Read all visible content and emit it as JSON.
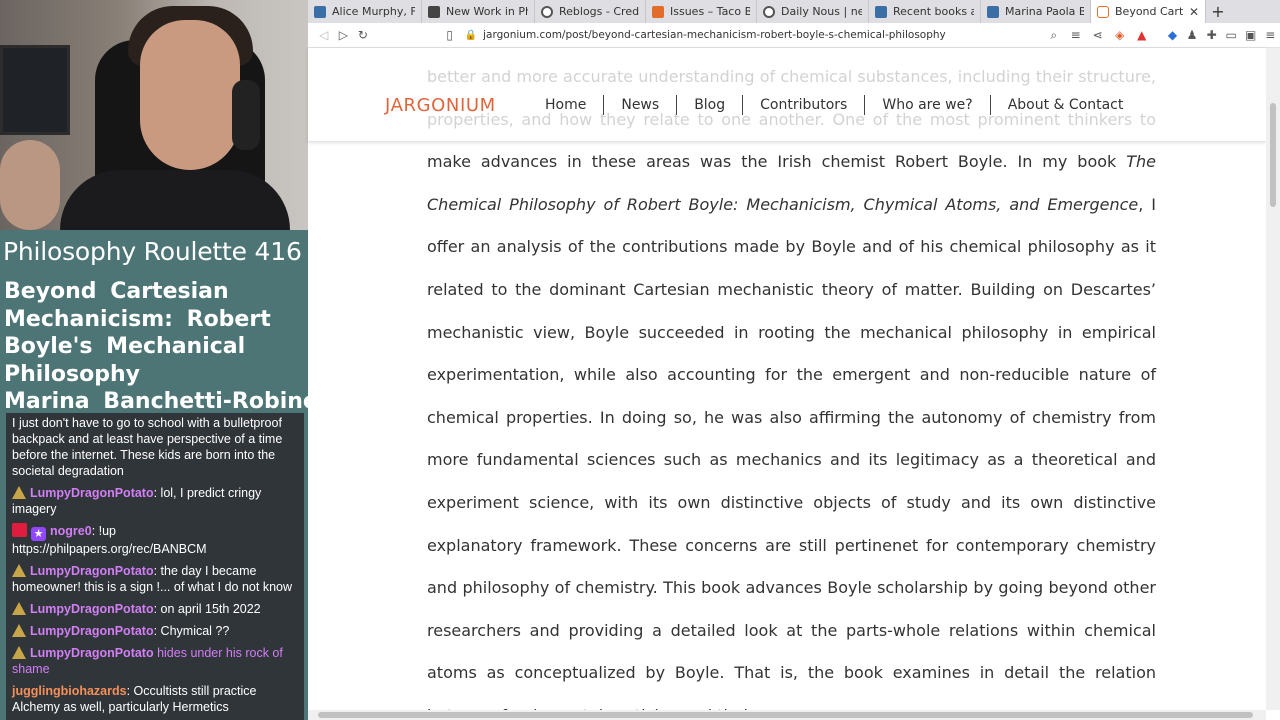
{
  "stream": {
    "title": "Philosophy Roulette 416",
    "subtitle_lines": [
      "Beyond Cartesian",
      "Mechanicism: Robert",
      "Boyle's Mechanical",
      "Philosophy",
      "Marina Banchetti-Robino"
    ],
    "chat": [
      {
        "user": "",
        "text": "I just don't have to go to school with a bulletproof backpack and at least have perspective of a time before the internet. These kids are born into the societal degradation",
        "action": false
      },
      {
        "user": "LumpyDragonPotato",
        "text": ": lol, I predict cringy imagery",
        "action": false
      },
      {
        "user": "nogre0",
        "text": ": !up https://philpapers.org/rec/BANBCM",
        "action": false
      },
      {
        "user": "LumpyDragonPotato",
        "text": ": the day I became homeowner! this is a sign !... of what I do not know",
        "action": false
      },
      {
        "user": "LumpyDragonPotato",
        "text": ": on april 15th 2022",
        "action": false
      },
      {
        "user": "LumpyDragonPotato",
        "text": ": Chymical ??",
        "action": false
      },
      {
        "user": "LumpyDragonPotato",
        "text": " hides under his rock of shame",
        "action": true
      },
      {
        "user": "jugglingbiohazards",
        "text": ": Occultists still practice Alchemy as well, particularly Hermetics",
        "action": false
      }
    ]
  },
  "browser": {
    "tabs": [
      {
        "label": "Alice Murphy, For",
        "icon": "philpapers-icon"
      },
      {
        "label": "New Work in Phil",
        "icon": "philpapers-icon"
      },
      {
        "label": "Reblogs - Credits",
        "icon": "github-icon"
      },
      {
        "label": "Issues – Taco Bell",
        "icon": "gitlab-icon"
      },
      {
        "label": "Daily Nous | news",
        "icon": "dailynous-icon"
      },
      {
        "label": "Recent books and",
        "icon": "philpapers-icon"
      },
      {
        "label": "Marina Paola Bar",
        "icon": "philpapers-icon"
      },
      {
        "label": "Beyond Carte",
        "icon": "jargonium-icon",
        "active": true
      }
    ],
    "new_tab": "+",
    "url": "jargonium.com/post/beyond-cartesian-mechanicism-robert-boyle-s-chemical-philosophy"
  },
  "site": {
    "logo": "JARGONIUM",
    "nav": [
      "Home",
      "News",
      "Blog",
      "Contributors",
      "Who are we?",
      "About & Contact"
    ]
  },
  "article": {
    "intro": "better and more accurate understanding of chemical substances, including their structure, properties, and how they relate to one another.  One of the most prominent thinkers to make advances in these areas was the Irish chemist Robert Boyle.  In my book ",
    "book_title": "The Chemical Philosophy of Robert Boyle: Mechanicism, Chymical Atoms, and Emergence",
    "rest": ", I offer an analysis of the contributions made by Boyle and of his chemical philosophy as it related to the dominant Cartesian mechanistic theory of matter.  Building on Descartes’ mechanistic view, Boyle succeeded in rooting the mechanical philosophy in empirical experimentation, while also accounting for the emergent and non-reducible nature of chemical properties.  In doing so, he was also affirming the autonomy of chemistry from more fundamental sciences such as mechanics and its legitimacy as a theoretical and experiment science, with its own distinctive objects of study and its own distinctive explanatory framework.  These concerns are still pertinenet for contemporary chemistry and philosophy of chemistry.  This book advances Boyle scholarship by going beyond other researchers and providing a detailed look at the parts-whole relations within chemical atoms as conceptualized by Boyle.  That is, the book examines in detail the relation between fundamental particles and their"
  },
  "colors": {
    "stream_bg": "#4e7575",
    "chat_bg": "#30353a",
    "username": "#d27ef5",
    "logo": "#e0653a"
  }
}
